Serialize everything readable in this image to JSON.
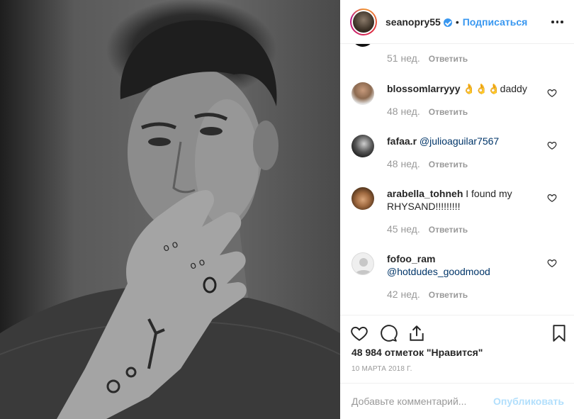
{
  "post_header": {
    "username": "seanopry55",
    "separator": "•",
    "follow_label": "Подписаться"
  },
  "comments": [
    {
      "username": "",
      "text": "",
      "mention": "",
      "time": "51 нед.",
      "reply_label": "Ответить",
      "avatar": "partial-hidden"
    },
    {
      "username": "blossomlarryyy",
      "text": "👌👌👌daddy",
      "mention": "",
      "time": "48 нед.",
      "reply_label": "Ответить"
    },
    {
      "username": "fafaa.r",
      "text": "",
      "mention": "@julioaguilar7567",
      "time": "48 нед.",
      "reply_label": "Ответить"
    },
    {
      "username": "arabella_tohneh",
      "text": "I found my RHYSAND!!!!!!!!!",
      "mention": "",
      "time": "45 нед.",
      "reply_label": "Ответить"
    },
    {
      "username": "fofoo_ram",
      "text": "",
      "mention": "@hotdudes_goodmood",
      "time": "42 нед.",
      "reply_label": "Ответить"
    }
  ],
  "likes": "48 984 отметок \"Нравится\"",
  "date": "10 марта 2018 г.",
  "add_comment": {
    "placeholder": "Добавьте комментарий...",
    "post_label": "Опубликовать"
  },
  "colors": {
    "link": "#3897f0",
    "mention": "#003569",
    "muted": "#999999",
    "post_disabled": "#b2dffc"
  }
}
